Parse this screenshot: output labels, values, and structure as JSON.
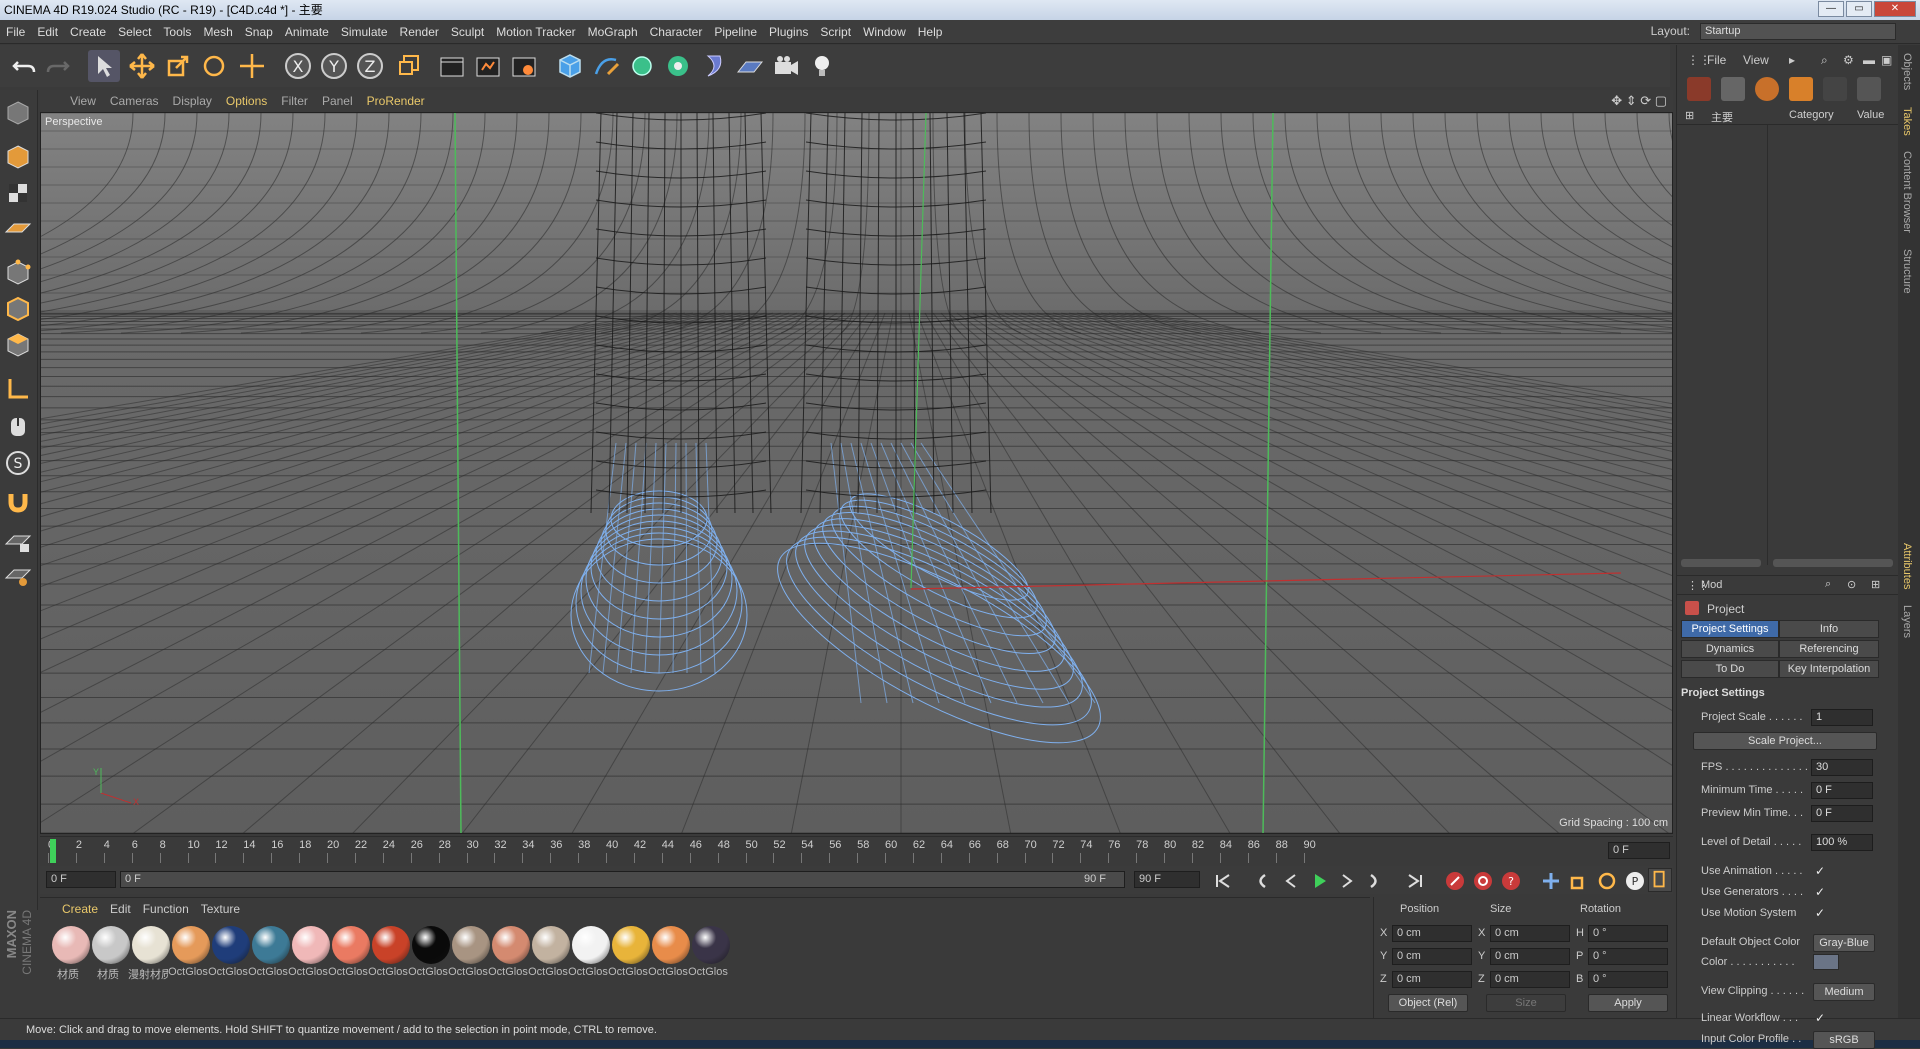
{
  "window": {
    "title": "CINEMA 4D R19.024 Studio (RC - R19) - [C4D.c4d *] - 主要",
    "min": "—",
    "max": "▭",
    "close": "✕"
  },
  "menubar": {
    "items": [
      "File",
      "Edit",
      "Create",
      "Select",
      "Tools",
      "Mesh",
      "Snap",
      "Animate",
      "Simulate",
      "Render",
      "Sculpt",
      "Motion Tracker",
      "MoGraph",
      "Character",
      "Pipeline",
      "Plugins",
      "Script",
      "Window",
      "Help"
    ]
  },
  "layout": {
    "label": "Layout:",
    "value": "Startup"
  },
  "viewport": {
    "menu": [
      "View",
      "Cameras",
      "Display",
      "Options",
      "Filter",
      "Panel",
      "ProRender"
    ],
    "label": "Perspective",
    "grid_spacing": "Grid Spacing : 100 cm",
    "axis_y": "Y",
    "axis_x": "X"
  },
  "timeline": {
    "ticks": [
      "0",
      "2",
      "4",
      "6",
      "8",
      "10",
      "12",
      "14",
      "16",
      "18",
      "20",
      "22",
      "24",
      "26",
      "28",
      "30",
      "32",
      "34",
      "36",
      "38",
      "40",
      "42",
      "44",
      "46",
      "48",
      "50",
      "52",
      "54",
      "56",
      "58",
      "60",
      "62",
      "64",
      "66",
      "68",
      "70",
      "72",
      "74",
      "76",
      "78",
      "80",
      "82",
      "84",
      "86",
      "88",
      "90"
    ],
    "current": "0 F"
  },
  "transport": {
    "start": "0 F",
    "range_start": "0 F",
    "range_end": "90 F",
    "end": "90 F"
  },
  "materials": {
    "tabs": [
      "Create",
      "Edit",
      "Function",
      "Texture"
    ],
    "items": [
      {
        "name": "材质",
        "color": "#e8b9b6"
      },
      {
        "name": "材质",
        "color": "#c8c8c8"
      },
      {
        "name": "漫射材质",
        "color": "#e7e2d4"
      },
      {
        "name": "OctGlos",
        "color": "#e59a5a"
      },
      {
        "name": "OctGlos",
        "color": "#1f3d7a"
      },
      {
        "name": "OctGlos",
        "color": "#3d7a96"
      },
      {
        "name": "OctGlos",
        "color": "#f0b8b8"
      },
      {
        "name": "OctGlos",
        "color": "#ea7a62"
      },
      {
        "name": "OctGlos",
        "color": "#c94228"
      },
      {
        "name": "OctGlos",
        "color": "#0a0a0a"
      },
      {
        "name": "OctGlos",
        "color": "#a89482"
      },
      {
        "name": "OctGlos",
        "color": "#d48a70"
      },
      {
        "name": "OctGlos",
        "color": "#c2b2a0"
      },
      {
        "name": "OctGlos",
        "color": "#f2f2f2"
      },
      {
        "name": "OctGlos",
        "color": "#e8b43a"
      },
      {
        "name": "OctGlos",
        "color": "#e88c4a"
      },
      {
        "name": "OctGlos",
        "color": "#3a3448"
      }
    ]
  },
  "coords": {
    "headers": [
      "Position",
      "Size",
      "Rotation"
    ],
    "rows": [
      {
        "axis": "X",
        "pos": "0 cm",
        "saxis": "X",
        "size": "0 cm",
        "raxis": "H",
        "rot": "0 °"
      },
      {
        "axis": "Y",
        "pos": "0 cm",
        "saxis": "Y",
        "size": "0 cm",
        "raxis": "P",
        "rot": "0 °"
      },
      {
        "axis": "Z",
        "pos": "0 cm",
        "saxis": "Z",
        "size": "0 cm",
        "raxis": "B",
        "rot": "0 °"
      }
    ],
    "mode": "Object (Rel)",
    "size_mode": "Size",
    "apply": "Apply"
  },
  "status": "Move: Click and drag to move elements. Hold SHIFT to quantize movement / add to the selection in point mode, CTRL to remove.",
  "objects": {
    "menu": [
      "File",
      "View"
    ],
    "root": "主要",
    "col_category": "Category",
    "col_value": "Value"
  },
  "attributes": {
    "mode": "Mod",
    "title": "Project",
    "tabs": [
      "Project Settings",
      "Info",
      "Dynamics",
      "Referencing",
      "To Do",
      "Key Interpolation"
    ],
    "section": "Project Settings",
    "rows": {
      "scale_label": "Project Scale . . . . . .",
      "scale_value": "1",
      "scale_btn": "Scale Project...",
      "fps_label": "FPS . . . . . . . . . . . . . .",
      "fps_value": "30",
      "min_label": "Minimum Time . . . . .",
      "min_value": "0 F",
      "pmin_label": "Preview Min Time. . .",
      "pmin_value": "0 F",
      "lod_label": "Level of Detail . . . . .",
      "lod_value": "100 %",
      "anim_label": "Use Animation . . . . .",
      "gen_label": "Use Generators . . . .",
      "motion_label": "Use Motion System",
      "doc_label": "Default Object Color",
      "doc_value": "Gray-Blue",
      "color_label": "Color . . . . . . . . . . .",
      "clip_label": "View Clipping . . . . . .",
      "clip_value": "Medium",
      "lw_label": "Linear Workflow . . .",
      "icp_label": "Input Color Profile . .",
      "icp_value": "sRGB"
    },
    "check": "✓"
  },
  "side_tabs": [
    "Objects",
    "Takes",
    "Content Browser",
    "Structure",
    "Attributes",
    "Layers"
  ],
  "brand": [
    "MAXON",
    "CINEMA 4D"
  ]
}
